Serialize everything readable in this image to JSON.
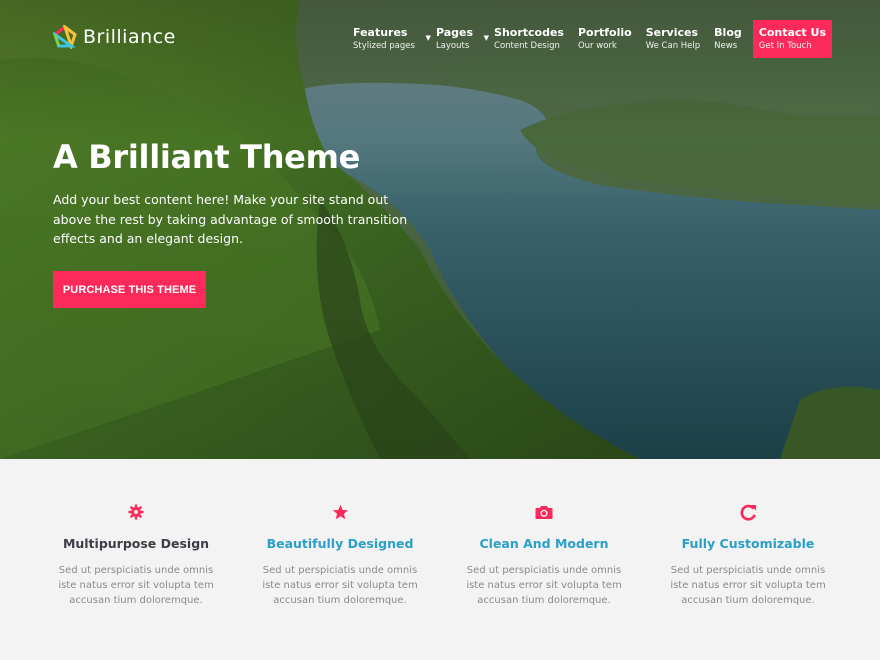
{
  "brand": {
    "name": "Brilliance"
  },
  "nav": [
    {
      "title": "Features",
      "subtitle": "Stylized pages",
      "has_dropdown": true
    },
    {
      "title": "Pages",
      "subtitle": "Layouts",
      "has_dropdown": true
    },
    {
      "title": "Shortcodes",
      "subtitle": "Content Design",
      "has_dropdown": false
    },
    {
      "title": "Portfolio",
      "subtitle": "Our work",
      "has_dropdown": false
    },
    {
      "title": "Services",
      "subtitle": "We Can Help",
      "has_dropdown": false
    },
    {
      "title": "Blog",
      "subtitle": "News",
      "has_dropdown": false
    },
    {
      "title": "Contact Us",
      "subtitle": "Get In Touch",
      "has_dropdown": false
    }
  ],
  "hero": {
    "title": "A Brilliant Theme",
    "text": "Add your best content here! Make your site stand out above the rest by taking advantage of smooth transition effects and an elegant design.",
    "cta_label": "PURCHASE THIS THEME"
  },
  "features": [
    {
      "icon": "gear-icon",
      "title": "Multipurpose Design",
      "title_color": "#3d3d45",
      "text": "Sed ut perspiciatis unde omnis iste natus error sit volupta tem accusan tium doloremque."
    },
    {
      "icon": "star-icon",
      "title": "Beautifully Designed",
      "title_color": "#2a9fc9",
      "text": "Sed ut perspiciatis unde omnis iste natus error sit volupta tem accusan tium doloremque."
    },
    {
      "icon": "camera-icon",
      "title": "Clean And Modern",
      "title_color": "#2a9fc9",
      "text": "Sed ut perspiciatis unde omnis iste natus error sit volupta tem accusan tium doloremque."
    },
    {
      "icon": "refresh-icon",
      "title": "Fully Customizable",
      "title_color": "#2a9fc9",
      "text": "Sed ut perspiciatis unde omnis iste natus error sit volupta tem accusan tium doloremque."
    }
  ],
  "colors": {
    "accent": "#fb2a5b",
    "link": "#2a9fc9",
    "feature_bg": "#f3f3f4",
    "water": "#2d5560"
  }
}
